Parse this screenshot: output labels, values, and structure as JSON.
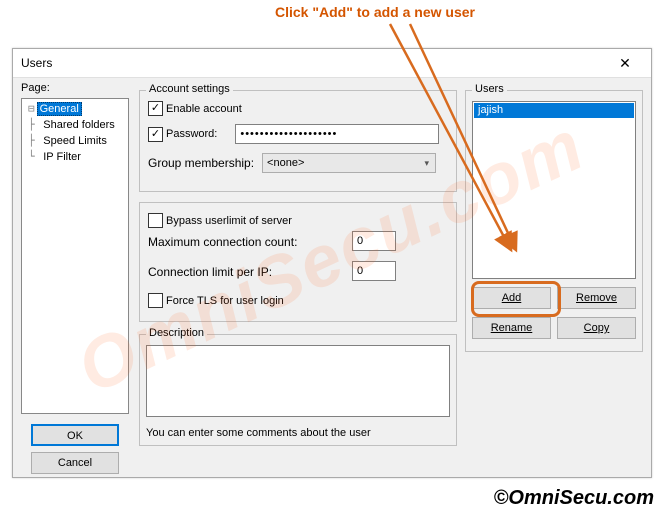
{
  "instruction": "Click  \"Add\" to add a new user",
  "watermark": "OmniSecu.com",
  "copyright": "©OmniSecu.com",
  "dialog": {
    "title": "Users",
    "close": "✕"
  },
  "page": {
    "label": "Page:",
    "items": [
      "General",
      "Shared folders",
      "Speed Limits",
      "IP Filter"
    ],
    "selected": "General"
  },
  "account": {
    "legend": "Account settings",
    "enable_label": "Enable account",
    "enable_checked": true,
    "password_label": "Password:",
    "password_checked": true,
    "password_value": "••••••••••••••••••••",
    "group_label": "Group membership:",
    "group_value": "<none>"
  },
  "limits": {
    "bypass_label": "Bypass userlimit of server",
    "bypass_checked": false,
    "max_conn_label": "Maximum connection count:",
    "max_conn_value": "0",
    "conn_ip_label": "Connection limit per IP:",
    "conn_ip_value": "0",
    "force_tls_label": "Force TLS for user login",
    "force_tls_checked": false
  },
  "description": {
    "legend": "Description",
    "hint": "You can enter some comments about the user"
  },
  "users": {
    "legend": "Users",
    "items": [
      "jajish"
    ],
    "buttons": {
      "add": "Add",
      "remove": "Remove",
      "rename": "Rename",
      "copy": "Copy"
    }
  },
  "footer": {
    "ok": "OK",
    "cancel": "Cancel"
  }
}
